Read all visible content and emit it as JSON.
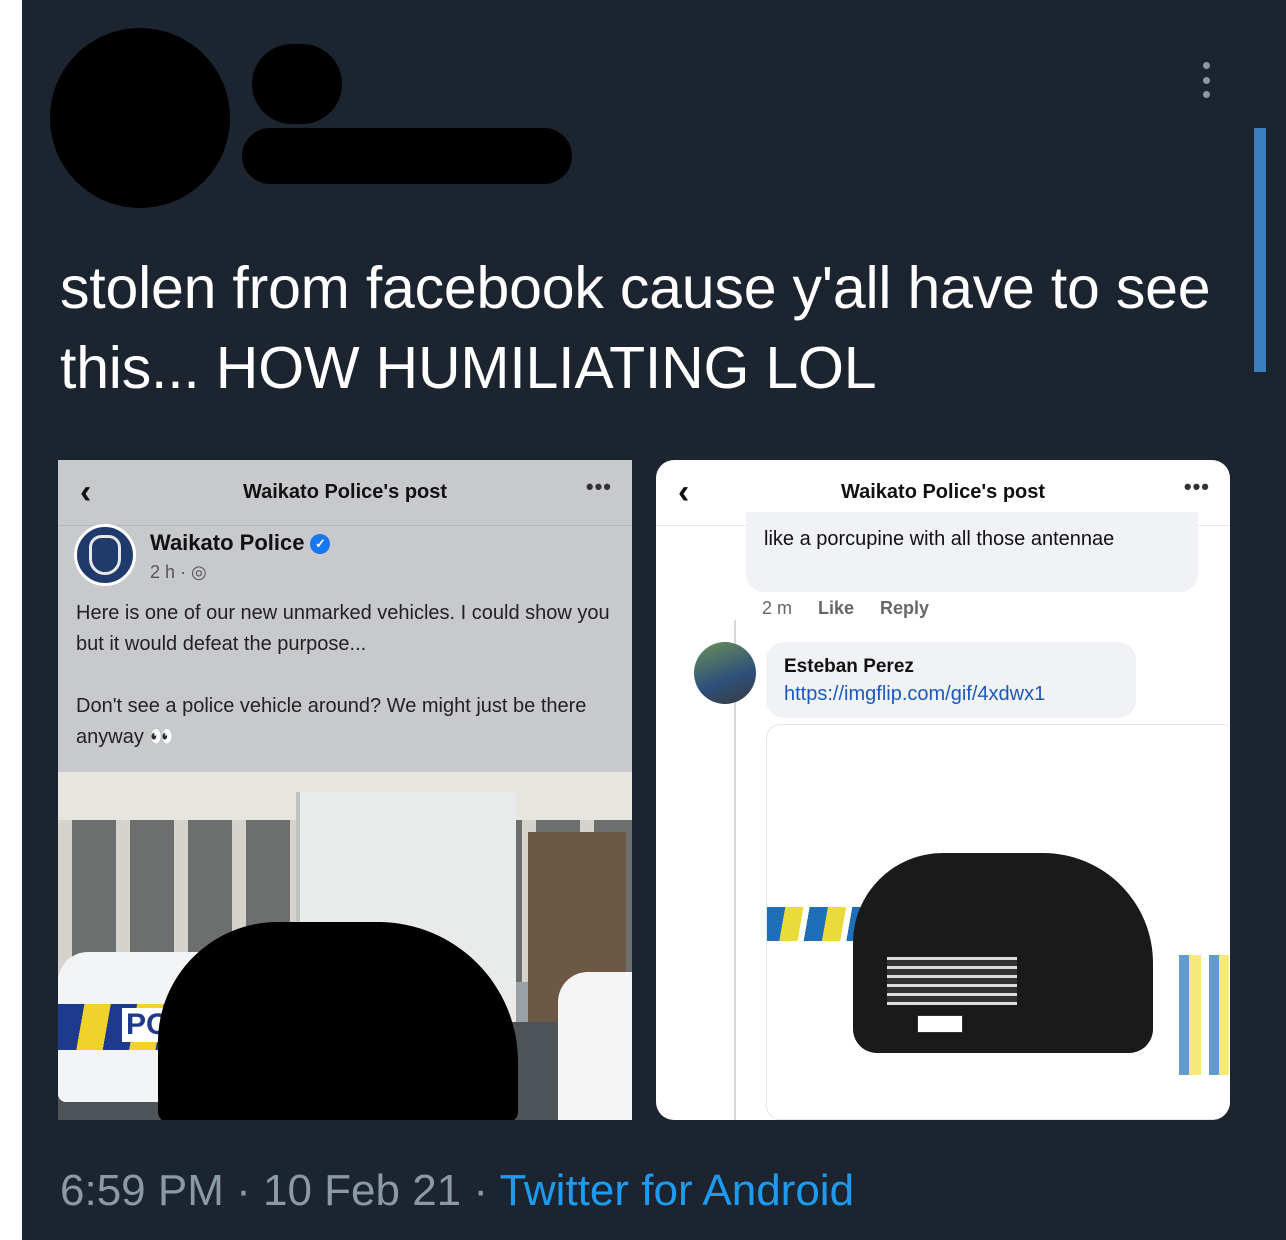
{
  "tweet": {
    "text": "stolen from facebook cause y'all have to see this... HOW HUMILIATING LOL",
    "time": "6:59 PM",
    "separator": " · ",
    "date": "10 Feb 21",
    "client": "Twitter for Android",
    "more_icon": "more-vertical-icon"
  },
  "left_post": {
    "header_title": "Waikato Police's post",
    "back_icon": "‹",
    "more_icon": "•••",
    "page_name": "Waikato Police",
    "verified_icon": "✓",
    "time": "2 h · ◎",
    "body_p1": "Here is one of our new unmarked vehicles. I could show you but it would defeat the purpose...",
    "body_p2": "Don't see a police vehicle around? We might just be there anyway 👀",
    "car_marking": "POLICE"
  },
  "right_post": {
    "header_title": "Waikato Police's post",
    "back_icon": "‹",
    "more_icon": "•••",
    "prev_comment": "like a porcupine with all those antennae",
    "prev_time": "2 m",
    "like_label": "Like",
    "reply_label": "Reply",
    "commenter": "Esteban Perez",
    "link": "https://imgflip.com/gif/4xdwx1"
  },
  "colors": {
    "background": "#1c2430",
    "link_blue": "#1d9bf0",
    "muted": "#8b98a5"
  }
}
